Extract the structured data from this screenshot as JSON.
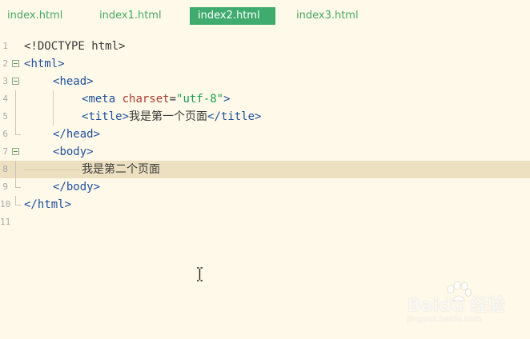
{
  "tabs": [
    {
      "label": "index.html",
      "active": false
    },
    {
      "label": "index1.html",
      "active": false
    },
    {
      "label": "index2.html",
      "active": true
    },
    {
      "label": "index3.html",
      "active": false
    }
  ],
  "editor": {
    "current_line": 8,
    "lines": [
      {
        "num": "1",
        "tokens": [
          "<!DOCTYPE html>"
        ]
      },
      {
        "num": "2",
        "tokens": [
          "<",
          "html",
          ">"
        ]
      },
      {
        "num": "3",
        "tokens": [
          "<",
          "head",
          ">"
        ]
      },
      {
        "num": "4",
        "tokens": [
          "<",
          "meta",
          " ",
          "charset",
          "=",
          "\"utf-8\"",
          ">"
        ]
      },
      {
        "num": "5",
        "tokens": [
          "<",
          "title",
          ">",
          "我是第一个页面",
          "</",
          "title",
          ">"
        ]
      },
      {
        "num": "6",
        "tokens": [
          "</",
          "head",
          ">"
        ]
      },
      {
        "num": "7",
        "tokens": [
          "<",
          "body",
          ">"
        ]
      },
      {
        "num": "8",
        "tokens": [
          "我是第二个页面"
        ]
      },
      {
        "num": "9",
        "tokens": [
          "</",
          "body",
          ">"
        ]
      },
      {
        "num": "10",
        "tokens": [
          "</",
          "html",
          ">"
        ]
      },
      {
        "num": "11",
        "tokens": []
      }
    ]
  },
  "watermark": {
    "brand": "Baidu 经验",
    "url": "jingyan.baidu.com"
  },
  "colors": {
    "background": "#fef9e8",
    "tab_active_bg": "#3fab6e",
    "tab_text": "#44a864",
    "tag": "#1f4f9e",
    "attribute": "#b03a2e",
    "string": "#1c9e55",
    "current_line_bg": "#ece0c1"
  },
  "icons": {
    "fold_marker": "fold-minus-icon",
    "cursor": "text-cursor-icon"
  }
}
